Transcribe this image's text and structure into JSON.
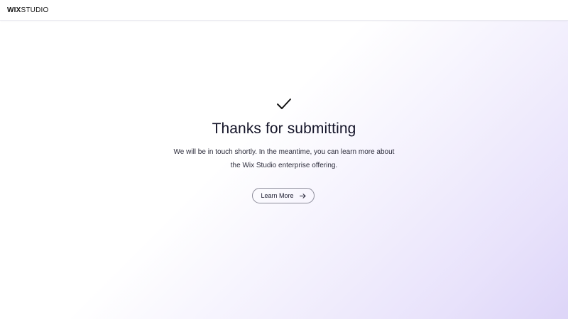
{
  "header": {
    "logo_bold": "WIX",
    "logo_light": "STUDIO"
  },
  "main": {
    "icon": "checkmark-icon",
    "title": "Thanks for submitting",
    "subtitle_line1": "We will be in touch shortly. In the meantime, you can learn more about",
    "subtitle_line2": "the Wix Studio enterprise offering.",
    "button_label": "Learn More",
    "button_icon": "arrow-right-icon"
  },
  "colors": {
    "background_gradient_end": "#ddd5f8",
    "text": "#141428",
    "button_border": "#8b8b99"
  }
}
